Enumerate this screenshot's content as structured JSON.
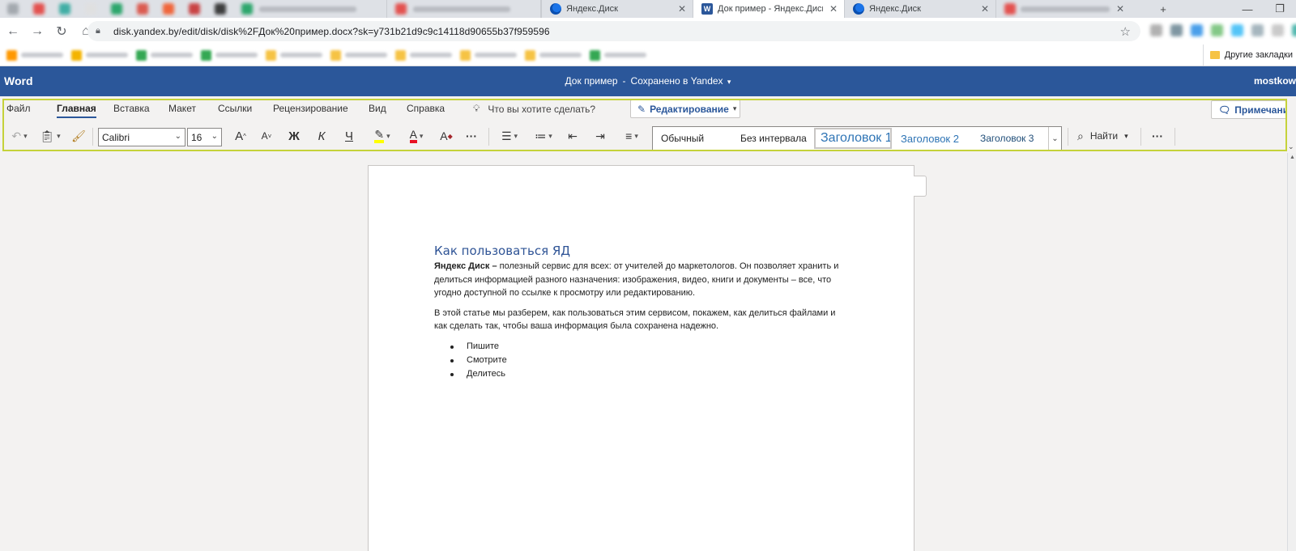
{
  "browser": {
    "tabs": [
      {
        "label": "",
        "favicon_color": "#9aa0a6"
      },
      {
        "label": "",
        "favicon_color": "#e53935"
      },
      {
        "label": "",
        "favicon_color": "#26a69a"
      },
      {
        "label": "",
        "favicon_color": "#e0e0e0"
      },
      {
        "label": "",
        "favicon_color": "#0f9d58"
      },
      {
        "label": "",
        "favicon_color": "#db4437"
      },
      {
        "label": "",
        "favicon_color": "#f4511e"
      },
      {
        "label": "",
        "favicon_color": "#c62828"
      },
      {
        "label": "",
        "favicon_color": "#212121"
      },
      {
        "label": "",
        "favicon_color": "#0f9d58"
      },
      {
        "label": "",
        "favicon_color": "#e53935"
      },
      {
        "label": "Яндекс.Диск",
        "favicon": "yandex-disk-icon"
      },
      {
        "label": "Док пример - Яндекс.Диск",
        "favicon": "word-doc-icon",
        "active": true
      },
      {
        "label": "Яндекс.Диск",
        "favicon": "yandex-disk-icon"
      },
      {
        "label": "",
        "favicon_color": "#e53935"
      }
    ],
    "new_tab_symbol": "+",
    "window_controls": {
      "minimize": "—",
      "restore": "❐"
    },
    "url": "disk.yandex.by/edit/disk/disk%2FДок%20пример.docx?sk=y731b21d9c9c14118d90655b37f959596",
    "extension_colors": [
      "#9e9e9e",
      "#607d8b",
      "#1e88e5",
      "#66bb6a",
      "#29b6f6",
      "#90a4ae",
      "#bdbdbd",
      "#26a69a"
    ],
    "bookmarks": [
      {
        "color": "#ff9800"
      },
      {
        "color": "#f4b400"
      },
      {
        "color": "#34a853"
      },
      {
        "color": "#34a853"
      },
      {
        "color": "#f6c344"
      },
      {
        "color": "#f6c344"
      },
      {
        "color": "#f6c344"
      },
      {
        "color": "#f6c344"
      },
      {
        "color": "#f6c344"
      },
      {
        "color": "#34a853"
      }
    ],
    "other_bookmarks": "Другие закладки"
  },
  "word": {
    "app_name": "Word",
    "doc_title": "Док пример",
    "separator": "-",
    "save_status": "Сохранено в Yandex",
    "user": "mostkow",
    "menu": [
      "Файл",
      "Главная",
      "Вставка",
      "Макет",
      "Ссылки",
      "Рецензирование",
      "Вид",
      "Справка"
    ],
    "active_menu_index": 1,
    "tell_me": "Что вы хотите сделать?",
    "editing_mode": "Редактирование",
    "comments": "Примечания",
    "font_name": "Calibri",
    "font_size": "16",
    "bold_label": "Ж",
    "italic_label": "К",
    "underline_label": "Ч",
    "grow_font_label": "A",
    "shrink_font_label": "A",
    "font_color_label": "A",
    "clear_format_label": "A",
    "more_label": "···",
    "styles": [
      "Обычный",
      "Без интервала",
      "Заголовок 1",
      "Заголовок 2",
      "Заголовок 3"
    ],
    "find_label": "Найти",
    "highlight_color": "#ffff00",
    "font_color": "#e81123"
  },
  "document": {
    "heading": "Как пользоваться ЯД",
    "p1_bold": "Яндекс Диск –",
    "p1_rest": " полезный сервис для всех: от учителей до маркетологов. Он позволяет хранить и делиться информацией разного назначения: изображения, видео, книги и документы – все, что угодно доступной по ссылке к просмотру или редактированию.",
    "p2": "В этой статье мы разберем, как пользоваться этим сервисом, покажем, как делиться файлами и как сделать так, чтобы ваша информация была сохранена надежно.",
    "list": [
      "Пишите",
      "Смотрите",
      "Делитесь"
    ]
  }
}
